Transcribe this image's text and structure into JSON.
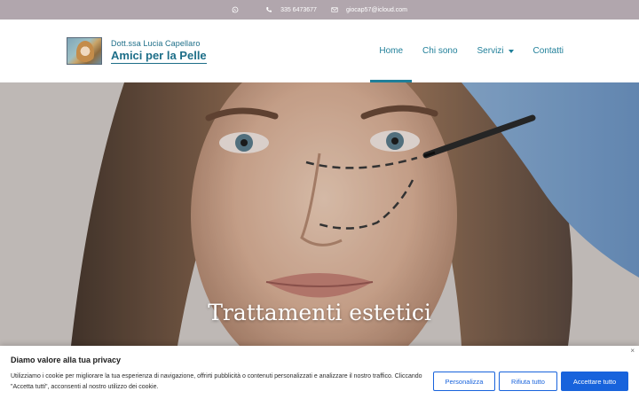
{
  "topbar": {
    "phone": "335 6473677",
    "email": "giocap57@icloud.com",
    "icons": [
      "whatsapp-icon",
      "phone-icon",
      "mail-icon"
    ]
  },
  "logo": {
    "subtitle": "Dott.ssa Lucia Capellaro",
    "title": "Amici per la Pelle"
  },
  "nav": {
    "items": [
      {
        "label": "Home",
        "active": true
      },
      {
        "label": "Chi sono"
      },
      {
        "label": "Servizi",
        "has_dropdown": true
      },
      {
        "label": "Contatti"
      }
    ]
  },
  "hero": {
    "title": "Trattamenti estetici"
  },
  "cookie": {
    "title": "Diamo valore alla tua privacy",
    "text": "Utilizziamo i cookie per migliorare la tua esperienza di navigazione, offrirti pubblicità o contenuti personalizzati e analizzare il nostro traffico. Cliccando \"Accetta tutti\", acconsenti al nostro utilizzo dei cookie.",
    "close": "×",
    "buttons": {
      "customize": "Personalizza",
      "reject": "Rifiuta tutto",
      "accept": "Accettare tutto"
    }
  },
  "colors": {
    "topbar_bg": "#b1a6ad",
    "brand": "#1f7f99",
    "cookie_button": "#1863dc"
  }
}
